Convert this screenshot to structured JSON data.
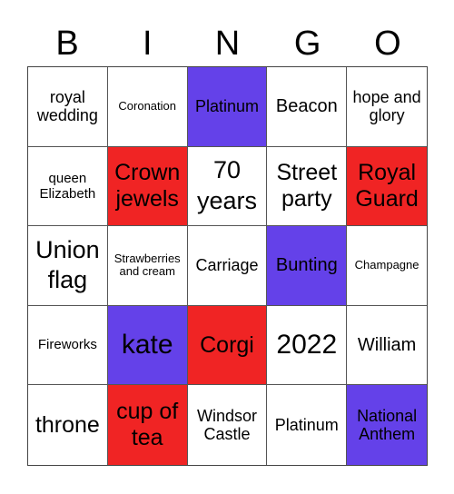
{
  "header": {
    "letters": [
      "B",
      "I",
      "N",
      "G",
      "O"
    ]
  },
  "colors": {
    "purple": "#6441E9",
    "red": "#F02424",
    "white": "#FFFFFF"
  },
  "cells": [
    {
      "text": "royal wedding",
      "color": "white"
    },
    {
      "text": "Coronation",
      "color": "white"
    },
    {
      "text": "Platinum",
      "color": "purple"
    },
    {
      "text": "Beacon",
      "color": "white"
    },
    {
      "text": "hope and glory",
      "color": "white"
    },
    {
      "text": "queen Elizabeth",
      "color": "white"
    },
    {
      "text": "Crown jewels",
      "color": "red"
    },
    {
      "text": "70 years",
      "color": "white"
    },
    {
      "text": "Street party",
      "color": "white"
    },
    {
      "text": "Royal Guard",
      "color": "red"
    },
    {
      "text": "Union flag",
      "color": "white"
    },
    {
      "text": "Strawberries and cream",
      "color": "white"
    },
    {
      "text": "Carriage",
      "color": "white"
    },
    {
      "text": "Bunting",
      "color": "purple"
    },
    {
      "text": "Champagne",
      "color": "white"
    },
    {
      "text": "Fireworks",
      "color": "white"
    },
    {
      "text": "kate",
      "color": "purple"
    },
    {
      "text": "Corgi",
      "color": "red"
    },
    {
      "text": "2022",
      "color": "white"
    },
    {
      "text": "William",
      "color": "white"
    },
    {
      "text": "throne",
      "color": "white"
    },
    {
      "text": "cup of tea",
      "color": "red"
    },
    {
      "text": "Windsor Castle",
      "color": "white"
    },
    {
      "text": "Platinum",
      "color": "white"
    },
    {
      "text": "National Anthem",
      "color": "purple"
    }
  ]
}
